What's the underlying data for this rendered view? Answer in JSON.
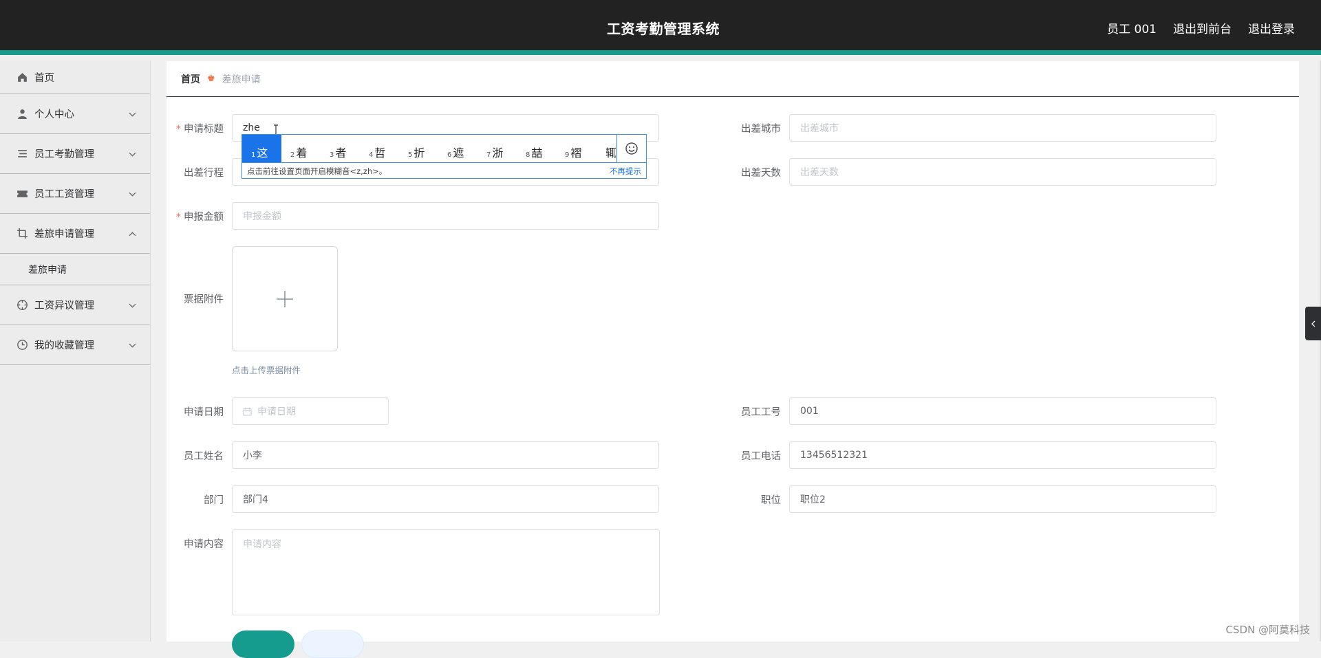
{
  "header": {
    "title": "工资考勤管理系统",
    "user": "员工 001",
    "back_to_front": "退出到前台",
    "logout": "退出登录"
  },
  "sidebar": {
    "items": [
      {
        "label": "首页",
        "icon": "home-icon"
      },
      {
        "label": "个人中心",
        "icon": "user-icon"
      },
      {
        "label": "员工考勤管理",
        "icon": "list-icon"
      },
      {
        "label": "员工工资管理",
        "icon": "ticket-icon"
      },
      {
        "label": "差旅申请管理",
        "icon": "crop-icon",
        "expanded": true
      },
      {
        "label": "工资异议管理",
        "icon": "target-icon"
      },
      {
        "label": "我的收藏管理",
        "icon": "clock-icon"
      }
    ],
    "subitem": "差旅申请"
  },
  "breadcrumb": {
    "home": "首页",
    "current": "差旅申请"
  },
  "form": {
    "title": {
      "label": "申请标题",
      "value": "zhe"
    },
    "city": {
      "label": "出差城市",
      "placeholder": "出差城市"
    },
    "itinerary": {
      "label": "出差行程"
    },
    "days": {
      "label": "出差天数",
      "placeholder": "出差天数"
    },
    "amount": {
      "label": "申报金额",
      "placeholder": "申报金额"
    },
    "attachment": {
      "label": "票据附件",
      "hint": "点击上传票据附件"
    },
    "date": {
      "label": "申请日期",
      "placeholder": "申请日期"
    },
    "emp_no": {
      "label": "员工工号",
      "value": "001"
    },
    "emp_name": {
      "label": "员工姓名",
      "value": "小李"
    },
    "emp_phone": {
      "label": "员工电话",
      "value": "13456512321"
    },
    "dept": {
      "label": "部门",
      "value": "部门4"
    },
    "position": {
      "label": "职位",
      "value": "职位2"
    },
    "content": {
      "label": "申请内容",
      "placeholder": "申请内容"
    }
  },
  "ime": {
    "candidates": [
      {
        "n": "1",
        "c": "这"
      },
      {
        "n": "2",
        "c": "着"
      },
      {
        "n": "3",
        "c": "者"
      },
      {
        "n": "4",
        "c": "哲"
      },
      {
        "n": "5",
        "c": "折"
      },
      {
        "n": "6",
        "c": "遮"
      },
      {
        "n": "7",
        "c": "浙"
      },
      {
        "n": "8",
        "c": "喆"
      },
      {
        "n": "9",
        "c": "褶"
      },
      {
        "n": "",
        "c": "辄"
      }
    ],
    "tip": "点击前往设置页面开启模糊音<z,zh>。",
    "dismiss": "不再提示"
  },
  "watermark": "CSDN @阿莫科技",
  "colors": {
    "accent": "#169c8e",
    "header_bg": "#222222",
    "ime_blue": "#1a73e8",
    "required": "#f56c6c"
  }
}
